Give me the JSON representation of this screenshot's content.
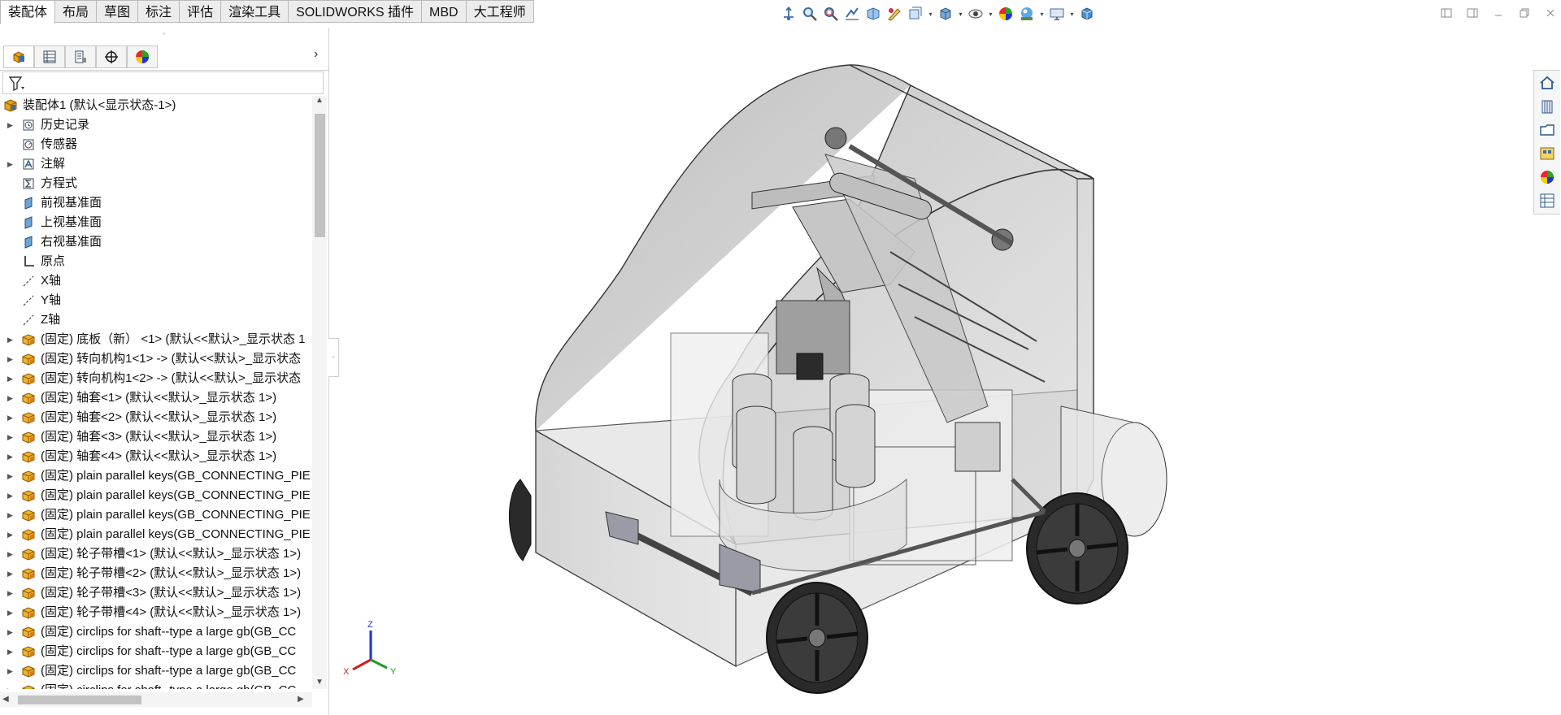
{
  "tabs": [
    {
      "label": "装配体",
      "active": true
    },
    {
      "label": "布局"
    },
    {
      "label": "草图"
    },
    {
      "label": "标注"
    },
    {
      "label": "评估"
    },
    {
      "label": "渲染工具"
    },
    {
      "label": "SOLIDWORKS 插件"
    },
    {
      "label": "MBD"
    },
    {
      "label": "大工程师"
    }
  ],
  "view_toolbar": {
    "icons": [
      "view-orientation-icon",
      "zoom-to-fit-icon",
      "zoom-to-area-icon",
      "previous-view-icon",
      "section-view-icon",
      "dynamic-annotation-icon",
      "view-selector-icon",
      "display-style-icon",
      "hide-show-icon",
      "edit-appearance-icon",
      "apply-scene-icon",
      "view-settings-icon",
      "display-pane-icon"
    ]
  },
  "window_controls": {
    "icons": [
      "tile-left-icon",
      "tile-right-icon",
      "restore-icon",
      "minimize-icon",
      "maximize-icon",
      "close-icon"
    ]
  },
  "feature_manager": {
    "tabs": [
      "featuremanager-tab-icon",
      "propertymanager-tab-icon",
      "configurationmanager-tab-icon",
      "dimxpert-tab-icon",
      "displaymanager-tab-icon"
    ],
    "root": "装配体1  (默认<显示状态-1>)",
    "items": [
      {
        "label": "历史记录",
        "icon": "history",
        "expandable": true
      },
      {
        "label": "传感器",
        "icon": "sensor",
        "expandable": false
      },
      {
        "label": "注解",
        "icon": "annotation",
        "expandable": true
      },
      {
        "label": "方程式",
        "icon": "equation",
        "expandable": false
      },
      {
        "label": "前视基准面",
        "icon": "plane",
        "expandable": false
      },
      {
        "label": "上视基准面",
        "icon": "plane",
        "expandable": false
      },
      {
        "label": "右视基准面",
        "icon": "plane",
        "expandable": false
      },
      {
        "label": "原点",
        "icon": "origin",
        "expandable": false
      },
      {
        "label": "X轴",
        "icon": "axis",
        "expandable": false
      },
      {
        "label": "Y轴",
        "icon": "axis",
        "expandable": false
      },
      {
        "label": "Z轴",
        "icon": "axis",
        "expandable": false
      },
      {
        "label": "(固定) 底板（新） <1> (默认<<默认>_显示状态 1",
        "icon": "part",
        "expandable": true
      },
      {
        "label": "(固定) 转向机构1<1> -> (默认<<默认>_显示状态",
        "icon": "part",
        "expandable": true
      },
      {
        "label": "(固定) 转向机构1<2> -> (默认<<默认>_显示状态",
        "icon": "part",
        "expandable": true
      },
      {
        "label": "(固定) 轴套<1> (默认<<默认>_显示状态 1>)",
        "icon": "part",
        "expandable": true
      },
      {
        "label": "(固定) 轴套<2> (默认<<默认>_显示状态 1>)",
        "icon": "part",
        "expandable": true
      },
      {
        "label": "(固定) 轴套<3> (默认<<默认>_显示状态 1>)",
        "icon": "part",
        "expandable": true
      },
      {
        "label": "(固定) 轴套<4> (默认<<默认>_显示状态 1>)",
        "icon": "part",
        "expandable": true
      },
      {
        "label": "(固定) plain parallel keys(GB_CONNECTING_PIE",
        "icon": "part",
        "expandable": true
      },
      {
        "label": "(固定) plain parallel keys(GB_CONNECTING_PIE",
        "icon": "part",
        "expandable": true
      },
      {
        "label": "(固定) plain parallel keys(GB_CONNECTING_PIE",
        "icon": "part",
        "expandable": true
      },
      {
        "label": "(固定) plain parallel keys(GB_CONNECTING_PIE",
        "icon": "part",
        "expandable": true
      },
      {
        "label": "(固定) 轮子带槽<1> (默认<<默认>_显示状态 1>)",
        "icon": "part",
        "expandable": true
      },
      {
        "label": "(固定) 轮子带槽<2> (默认<<默认>_显示状态 1>)",
        "icon": "part",
        "expandable": true
      },
      {
        "label": "(固定) 轮子带槽<3> (默认<<默认>_显示状态 1>)",
        "icon": "part",
        "expandable": true
      },
      {
        "label": "(固定) 轮子带槽<4> (默认<<默认>_显示状态 1>)",
        "icon": "part",
        "expandable": true
      },
      {
        "label": "(固定) circlips for shaft--type a large gb(GB_CC",
        "icon": "part",
        "expandable": true
      },
      {
        "label": "(固定) circlips for shaft--type a large gb(GB_CC",
        "icon": "part",
        "expandable": true
      },
      {
        "label": "(固定) circlips for shaft--type a large gb(GB_CC",
        "icon": "part",
        "expandable": true
      },
      {
        "label": "(固定) circlips for shaft--type a large gb(GB_CC",
        "icon": "part",
        "expandable": true
      }
    ]
  },
  "task_pane": {
    "icons": [
      "solidworks-resources-icon",
      "design-library-icon",
      "file-explorer-icon",
      "view-palette-icon",
      "appearances-icon",
      "custom-properties-icon"
    ]
  },
  "triad": {
    "x": "X",
    "y": "Y",
    "z": "Z"
  },
  "colors": {
    "accent": "#1a64c8",
    "tab_border": "#b9b9b9",
    "part_icon": "#e8a21a",
    "shell_gray": "#b8b8b8"
  }
}
